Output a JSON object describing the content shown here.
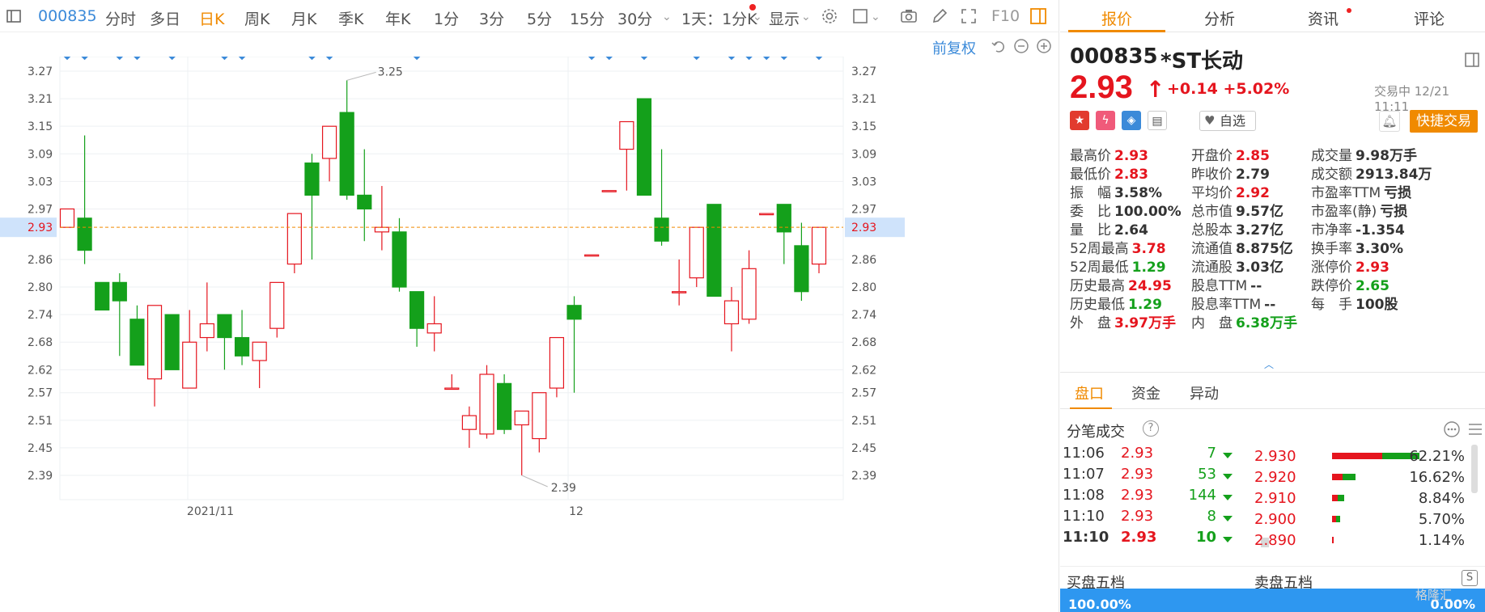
{
  "toolbar": {
    "code": "000835",
    "periods": [
      "分时",
      "多日",
      "日K",
      "周K",
      "月K",
      "季K",
      "年K",
      "1分",
      "3分",
      "5分",
      "15分",
      "30分"
    ],
    "active_period": "日K",
    "sub_period": "1天：1分K",
    "display": "显示",
    "f10": "F10"
  },
  "chart_controls": {
    "adjust": "前复权"
  },
  "chart_data": {
    "type": "candlestick",
    "y_ticks": [
      "3.27",
      "3.21",
      "3.15",
      "3.09",
      "3.03",
      "2.97",
      "2.93",
      "2.86",
      "2.80",
      "2.74",
      "2.68",
      "2.62",
      "2.57",
      "2.51",
      "2.45",
      "2.39"
    ],
    "current_price_label": "2.93",
    "current_price": 2.93,
    "x_labels": [
      "2021/11",
      "12"
    ],
    "high_label": "3.25",
    "low_label": "2.39",
    "colors": {
      "up": "#e5151e",
      "down": "#14a01b",
      "price_line": "#f08a00"
    },
    "candles": [
      {
        "o": 2.93,
        "c": 2.97,
        "h": 2.97,
        "l": 2.93
      },
      {
        "o": 2.95,
        "c": 2.88,
        "h": 3.13,
        "l": 2.85
      },
      {
        "o": 2.81,
        "c": 2.75,
        "h": 2.81,
        "l": 2.75
      },
      {
        "o": 2.81,
        "c": 2.77,
        "h": 2.83,
        "l": 2.65
      },
      {
        "o": 2.73,
        "c": 2.63,
        "h": 2.76,
        "l": 2.63
      },
      {
        "o": 2.6,
        "c": 2.76,
        "h": 2.76,
        "l": 2.54
      },
      {
        "o": 2.74,
        "c": 2.62,
        "h": 2.74,
        "l": 2.62
      },
      {
        "o": 2.58,
        "c": 2.68,
        "h": 2.75,
        "l": 2.58
      },
      {
        "o": 2.69,
        "c": 2.72,
        "h": 2.81,
        "l": 2.66
      },
      {
        "o": 2.74,
        "c": 2.69,
        "h": 2.74,
        "l": 2.62
      },
      {
        "o": 2.69,
        "c": 2.65,
        "h": 2.75,
        "l": 2.63
      },
      {
        "o": 2.64,
        "c": 2.68,
        "h": 2.68,
        "l": 2.58
      },
      {
        "o": 2.71,
        "c": 2.81,
        "h": 2.81,
        "l": 2.69
      },
      {
        "o": 2.85,
        "c": 2.96,
        "h": 2.96,
        "l": 2.83
      },
      {
        "o": 3.07,
        "c": 3.0,
        "h": 3.09,
        "l": 2.86
      },
      {
        "o": 3.08,
        "c": 3.15,
        "h": 3.15,
        "l": 3.03
      },
      {
        "o": 3.18,
        "c": 3.0,
        "h": 3.25,
        "l": 2.99
      },
      {
        "o": 3.0,
        "c": 2.97,
        "h": 3.1,
        "l": 2.9
      },
      {
        "o": 2.92,
        "c": 2.93,
        "h": 3.02,
        "l": 2.88
      },
      {
        "o": 2.92,
        "c": 2.8,
        "h": 2.95,
        "l": 2.79
      },
      {
        "o": 2.79,
        "c": 2.71,
        "h": 2.79,
        "l": 2.67
      },
      {
        "o": 2.7,
        "c": 2.72,
        "h": 2.78,
        "l": 2.66
      },
      {
        "o": 2.58,
        "c": 2.58,
        "h": 2.61,
        "l": 2.58
      },
      {
        "o": 2.49,
        "c": 2.52,
        "h": 2.54,
        "l": 2.45
      },
      {
        "o": 2.48,
        "c": 2.61,
        "h": 2.63,
        "l": 2.47
      },
      {
        "o": 2.59,
        "c": 2.49,
        "h": 2.61,
        "l": 2.48
      },
      {
        "o": 2.5,
        "c": 2.53,
        "h": 2.53,
        "l": 2.39
      },
      {
        "o": 2.47,
        "c": 2.57,
        "h": 2.57,
        "l": 2.44
      },
      {
        "o": 2.58,
        "c": 2.69,
        "h": 2.69,
        "l": 2.56
      },
      {
        "o": 2.76,
        "c": 2.73,
        "h": 2.78,
        "l": 2.57
      },
      {
        "o": 2.87,
        "c": 2.87,
        "h": 2.87,
        "l": 2.87
      },
      {
        "o": 3.01,
        "c": 3.01,
        "h": 3.01,
        "l": 3.01
      },
      {
        "o": 3.1,
        "c": 3.16,
        "h": 3.16,
        "l": 3.01
      },
      {
        "o": 3.21,
        "c": 3.0,
        "h": 3.21,
        "l": 3.0
      },
      {
        "o": 2.95,
        "c": 2.9,
        "h": 3.1,
        "l": 2.89
      },
      {
        "o": 2.79,
        "c": 2.79,
        "h": 2.86,
        "l": 2.76
      },
      {
        "o": 2.82,
        "c": 2.93,
        "h": 2.93,
        "l": 2.8
      },
      {
        "o": 2.98,
        "c": 2.78,
        "h": 2.98,
        "l": 2.78
      },
      {
        "o": 2.72,
        "c": 2.77,
        "h": 2.8,
        "l": 2.66
      },
      {
        "o": 2.73,
        "c": 2.84,
        "h": 2.88,
        "l": 2.72
      },
      {
        "o": 2.96,
        "c": 2.96,
        "h": 2.96,
        "l": 2.96
      },
      {
        "o": 2.98,
        "c": 2.92,
        "h": 2.98,
        "l": 2.85
      },
      {
        "o": 2.89,
        "c": 2.79,
        "h": 2.94,
        "l": 2.77
      },
      {
        "o": 2.85,
        "c": 2.93,
        "h": 2.93,
        "l": 2.83
      }
    ]
  },
  "tabs": [
    "报价",
    "分析",
    "资讯",
    "评论"
  ],
  "stock": {
    "code": "000835",
    "name": "*ST长动",
    "price": "2.93",
    "change": "+0.14",
    "change_pct": "+5.02%",
    "status": "交易中 12/21 11:11",
    "watch_label": "自选",
    "trade_label": "快捷交易"
  },
  "stats": [
    [
      {
        "l": "最高价",
        "v": "2.93",
        "c": "red"
      },
      {
        "l": "开盘价",
        "v": "2.85",
        "c": "red"
      },
      {
        "l": "成交量",
        "v": "9.98万手",
        "c": "dark"
      }
    ],
    [
      {
        "l": "最低价",
        "v": "2.83",
        "c": "red"
      },
      {
        "l": "昨收价",
        "v": "2.79",
        "c": "dark"
      },
      {
        "l": "成交额",
        "v": "2913.84万",
        "c": "dark"
      }
    ],
    [
      {
        "l": "振　幅",
        "v": "3.58%",
        "c": "dark"
      },
      {
        "l": "平均价",
        "v": "2.92",
        "c": "red"
      },
      {
        "l": "市盈率TTM",
        "v": "亏损",
        "c": "dark"
      }
    ],
    [
      {
        "l": "委　比",
        "v": "100.00%",
        "c": "dark"
      },
      {
        "l": "总市值",
        "v": "9.57亿",
        "c": "dark"
      },
      {
        "l": "市盈率(静)",
        "v": "亏损",
        "c": "dark"
      }
    ],
    [
      {
        "l": "量　比",
        "v": "2.64",
        "c": "dark"
      },
      {
        "l": "总股本",
        "v": "3.27亿",
        "c": "dark"
      },
      {
        "l": "市净率",
        "v": "-1.354",
        "c": "dark"
      }
    ],
    [
      {
        "l": "52周最高",
        "v": "3.78",
        "c": "red"
      },
      {
        "l": "流通值",
        "v": "8.875亿",
        "c": "dark"
      },
      {
        "l": "换手率",
        "v": "3.30%",
        "c": "dark"
      }
    ],
    [
      {
        "l": "52周最低",
        "v": "1.29",
        "c": "green"
      },
      {
        "l": "流通股",
        "v": "3.03亿",
        "c": "dark"
      },
      {
        "l": "涨停价",
        "v": "2.93",
        "c": "red"
      }
    ],
    [
      {
        "l": "历史最高",
        "v": "24.95",
        "c": "red"
      },
      {
        "l": "股息TTM",
        "v": "--",
        "c": "dark"
      },
      {
        "l": "跌停价",
        "v": "2.65",
        "c": "green"
      }
    ],
    [
      {
        "l": "历史最低",
        "v": "1.29",
        "c": "green"
      },
      {
        "l": "股息率TTM",
        "v": "--",
        "c": "dark"
      },
      {
        "l": "每　手",
        "v": "100股",
        "c": "dark"
      }
    ],
    [
      {
        "l": "外　盘",
        "v": "3.97万手",
        "c": "red"
      },
      {
        "l": "内　盘",
        "v": "6.38万手",
        "c": "green"
      }
    ]
  ],
  "subtabs": [
    "盘口",
    "资金",
    "异动"
  ],
  "ticks_title": "分笔成交",
  "ticks": [
    {
      "t": "11:06",
      "p": "2.93",
      "v": "7"
    },
    {
      "t": "11:07",
      "p": "2.93",
      "v": "53"
    },
    {
      "t": "11:08",
      "p": "2.93",
      "v": "144"
    },
    {
      "t": "11:10",
      "p": "2.93",
      "v": "8"
    },
    {
      "t": "11:10",
      "p": "2.93",
      "v": "10"
    }
  ],
  "distribution": [
    {
      "p": "2.930",
      "pct": "62.21%",
      "share": 0.6221,
      "red": 0.57
    },
    {
      "p": "2.920",
      "pct": "16.62%",
      "share": 0.1662,
      "red": 0.45
    },
    {
      "p": "2.910",
      "pct": "8.84%",
      "share": 0.0884,
      "red": 0.45
    },
    {
      "p": "2.900",
      "pct": "5.70%",
      "share": 0.057,
      "red": 0.5
    },
    {
      "p": "2.890",
      "pct": "1.14%",
      "share": 0.0114,
      "red": 1
    }
  ],
  "level5": {
    "buy": "买盘五档",
    "sell": "卖盘五档",
    "buy_pct": "100.00%",
    "sell_pct": "0.00%"
  },
  "watermark": "格隆汇"
}
